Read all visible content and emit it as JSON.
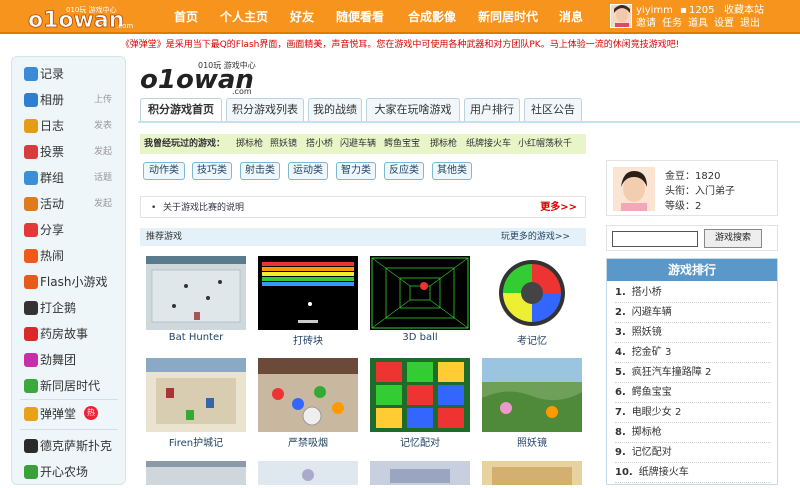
{
  "site": {
    "logo_text": "o1owan",
    "logo_small": "010玩 游戏中心",
    "logo_com": ".com"
  },
  "nav": [
    "首页",
    "个人主页",
    "好友",
    "随便看看",
    "合成影像",
    "新同居时代",
    "消息"
  ],
  "user": {
    "name": "yiyimm",
    "coins": "1205",
    "links": [
      "收藏本站",
      "邀请",
      "任务",
      "道具",
      "设置",
      "退出"
    ]
  },
  "marquee": "《弹弹堂》是采用当下最Q的Flash界面，画面精美，声音悦耳。您在游戏中可使用各种武器和对方团队PK。马上体验一流的休闲竞技游戏吧!",
  "sidebar": [
    {
      "label": "记录",
      "extra": "",
      "icon": "record-icon",
      "color": "#3a8ad8"
    },
    {
      "label": "相册",
      "extra": "上传",
      "icon": "album-icon",
      "color": "#2f7fd0"
    },
    {
      "label": "日志",
      "extra": "发表",
      "icon": "blog-icon",
      "color": "#e49b18"
    },
    {
      "label": "投票",
      "extra": "发起",
      "icon": "vote-icon",
      "color": "#d83b3b"
    },
    {
      "label": "群组",
      "extra": "话题",
      "icon": "group-icon",
      "color": "#3b8fd8"
    },
    {
      "label": "活动",
      "extra": "发起",
      "icon": "event-icon",
      "color": "#e07b1b"
    },
    {
      "label": "分享",
      "extra": "",
      "icon": "share-icon",
      "color": "#e23a3a"
    },
    {
      "label": "热闹",
      "extra": "",
      "icon": "hot-icon",
      "color": "#ef5a1a"
    },
    {
      "label": "Flash小游戏",
      "extra": "",
      "icon": "flash-game-icon",
      "color": "#e85a1a"
    },
    {
      "label": "打企鹅",
      "extra": "",
      "icon": "penguin-icon",
      "color": "#333333"
    },
    {
      "label": "药房故事",
      "extra": "",
      "icon": "pharmacy-icon",
      "color": "#d92a2a"
    },
    {
      "label": "劲舞团",
      "extra": "",
      "icon": "dance-icon",
      "color": "#c52fa8"
    },
    {
      "label": "新同居时代",
      "extra": "",
      "icon": "home-icon",
      "color": "#3aa83a"
    },
    {
      "label": "弹弹堂",
      "extra": "",
      "icon": "ddt-icon",
      "color": "#e8a21a"
    },
    {
      "label": "德克萨斯扑克",
      "extra": "",
      "icon": "poker-icon",
      "color": "#2a2a2a"
    },
    {
      "label": "开心农场",
      "extra": "",
      "icon": "farm-icon",
      "color": "#3aa03a"
    }
  ],
  "hot_badge": "热",
  "tabs": [
    "积分游戏首页",
    "积分游戏列表",
    "我的战绩",
    "大家在玩啥游戏",
    "用户排行",
    "社区公告"
  ],
  "played": {
    "label": "我曾经玩过的游戏：",
    "games": [
      "掷标枪",
      "照妖镜",
      "搭小桥",
      "闪避车辆",
      "鳄鱼宝宝",
      "掷标枪",
      "纸牌接火车",
      "小红帽荡秋千"
    ]
  },
  "categories": [
    "动作类",
    "技巧类",
    "射击类",
    "运动类",
    "智力类",
    "反应类",
    "其他类"
  ],
  "notice": {
    "text": "关于游戏比赛的说明",
    "more": "更多>>"
  },
  "recommend": {
    "title": "推荐游戏",
    "more": "玩更多的游戏>>"
  },
  "games": [
    "Bat Hunter",
    "打砖块",
    "3D ball",
    "考记忆",
    "Firen护城记",
    "严禁吸烟",
    "记忆配对",
    "照妖镜"
  ],
  "profile": {
    "gold": "金豆：1820",
    "title": "头衔：入门弟子",
    "level": "等级：2"
  },
  "search": {
    "placeholder": "",
    "button": "游戏搜索"
  },
  "ranking": {
    "title": "游戏排行",
    "items": [
      "搭小桥",
      "闪避车辆",
      "照妖镜",
      "挖金矿 3",
      "疯狂汽车撞路障 2",
      "鳄鱼宝宝",
      "电眼少女 2",
      "掷标枪",
      "记忆配对",
      "纸牌接火车"
    ]
  }
}
